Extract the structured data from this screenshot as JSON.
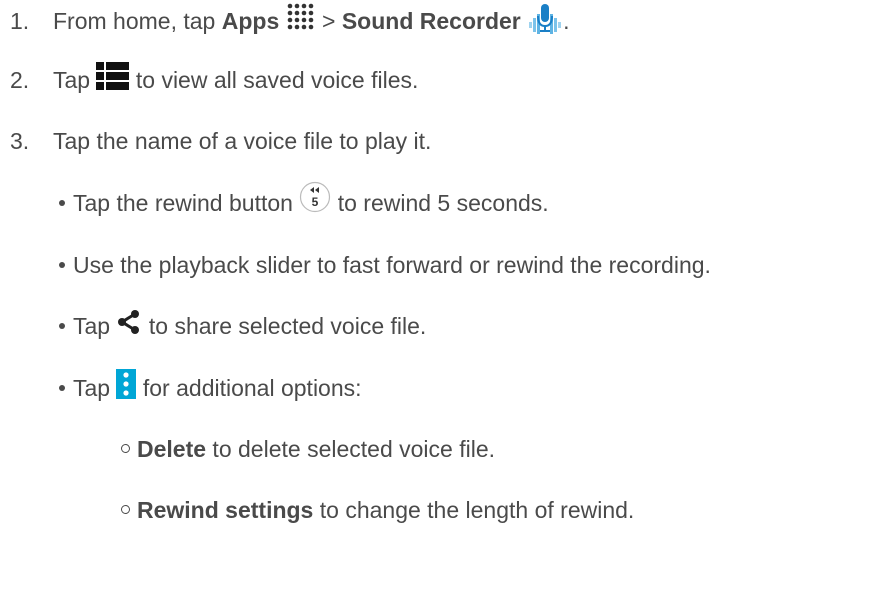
{
  "steps": [
    {
      "num": "1.",
      "a": "From home, tap ",
      "b1": "Apps",
      "c": " > ",
      "b2": "Sound Recorder",
      "d": "."
    },
    {
      "num": "2.",
      "a": "Tap ",
      "c": " to view all saved voice files."
    },
    {
      "num": "3.",
      "a": "Tap the name of a voice file to play it."
    }
  ],
  "bullets": [
    {
      "a": "Tap the rewind button ",
      "c": " to rewind 5 seconds."
    },
    {
      "a": "Use the playback slider to fast forward or rewind the recording."
    },
    {
      "a": "Tap ",
      "c": " to share selected voice file."
    },
    {
      "a": "Tap ",
      "c": " for additional options:"
    }
  ],
  "subbullets": [
    {
      "b": "Delete",
      "c": " to delete selected voice file."
    },
    {
      "b": "Rewind settings",
      "c": " to change the length of rewind."
    }
  ],
  "rewind_label": "5",
  "icons": {
    "apps": "apps-grid-icon",
    "recorder": "sound-recorder-icon",
    "list": "list-view-icon",
    "rewind": "rewind-5-icon",
    "share": "share-icon",
    "menu": "overflow-menu-icon"
  },
  "colors": {
    "text": "#4a4a4a",
    "accent": "#1a9ad6",
    "menu": "#00a6d6"
  }
}
